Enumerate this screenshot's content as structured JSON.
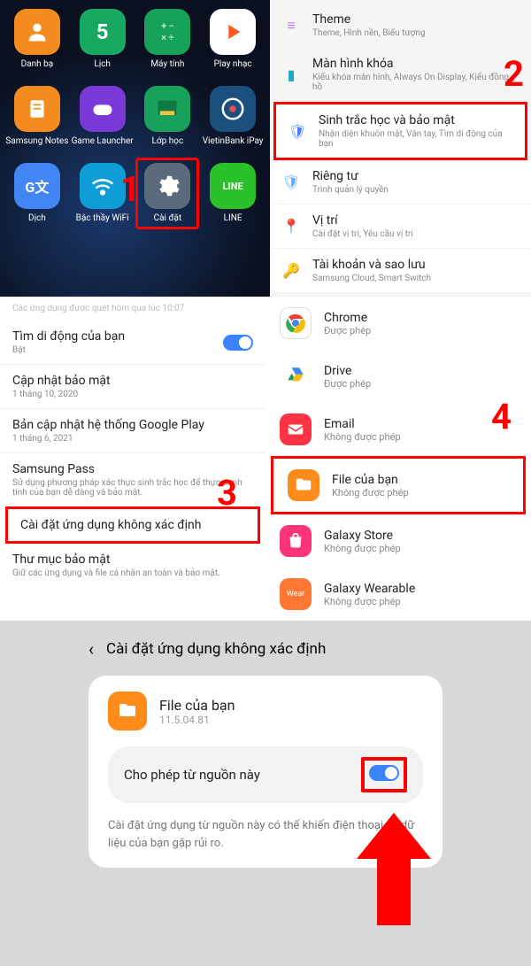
{
  "panel1": {
    "apps": [
      {
        "label": "Danh bạ"
      },
      {
        "label": "Lịch",
        "glyph": "5"
      },
      {
        "label": "Máy tính"
      },
      {
        "label": "Play nhạc"
      },
      {
        "label": "Samsung Notes"
      },
      {
        "label": "Game Launcher"
      },
      {
        "label": "Lớp học"
      },
      {
        "label": "VietinBank iPay"
      },
      {
        "label": "Dịch"
      },
      {
        "label": "Bậc thầy WiFi"
      },
      {
        "label": "Cài đặt"
      },
      {
        "label": "LINE",
        "glyph": "LINE"
      }
    ],
    "step": "1"
  },
  "panel2": {
    "items": [
      {
        "title": "Theme",
        "sub": "Theme, Hình nền, Biểu tượng"
      },
      {
        "title": "Màn hình khóa",
        "sub": "Kiểu khóa màn hình, Always On Display, Kiểu đồng hồ"
      },
      {
        "title": "Sinh trắc học và bảo mật",
        "sub": "Nhận diện khuôn mặt, Vân tay, Tìm di động của bạn"
      },
      {
        "title": "Riêng tư",
        "sub": "Trình quản lý quyền"
      },
      {
        "title": "Vị trí",
        "sub": "Cài đặt vị trí, Yêu cầu vị trí"
      },
      {
        "title": "Tài khoản và sao lưu",
        "sub": "Samsung Cloud, Smart Switch"
      }
    ],
    "step": "2"
  },
  "panel3": {
    "cutoff": "Các ứng dụng được quét hôm qua lúc 10:07",
    "items": [
      {
        "title": "Tìm di động của bạn",
        "sub": "Bật",
        "toggle": true
      },
      {
        "title": "Cập nhật bảo mật",
        "sub": "1 tháng 10, 2020"
      },
      {
        "title": "Bản cập nhật hệ thống Google Play",
        "sub": "1 tháng 6, 2021"
      },
      {
        "title": "Samsung Pass",
        "sub": "Sử dụng phương pháp xác thực sinh trắc học để thực danh tính của bạn dễ dàng và bảo mật."
      },
      {
        "title": "Cài đặt ứng dụng không xác định"
      },
      {
        "title": "Thư mục bảo mật",
        "sub": "Giữ các ứng dụng và file cá nhân an toàn và bảo mật."
      }
    ],
    "step": "3"
  },
  "panel4": {
    "apps": [
      {
        "title": "Chrome",
        "sub": "Được phép"
      },
      {
        "title": "Drive",
        "sub": "Được phép"
      },
      {
        "title": "Email",
        "sub": "Không được phép"
      },
      {
        "title": "File của bạn",
        "sub": "Không được phép"
      },
      {
        "title": "Galaxy Store",
        "sub": "Không được phép"
      },
      {
        "title": "Galaxy Wearable",
        "sub": "Không được phép"
      }
    ],
    "step": "4",
    "wear": "Wear"
  },
  "panel5": {
    "header": "Cài đặt ứng dụng không xác định",
    "app_title": "File của bạn",
    "app_version": "11.5.04.81",
    "toggle_label": "Cho phép từ nguồn này",
    "warning": "Cài đặt ứng dụng từ nguồn này có thể khiến điện thoại và dữ liệu của bạn gặp rủi ro."
  }
}
